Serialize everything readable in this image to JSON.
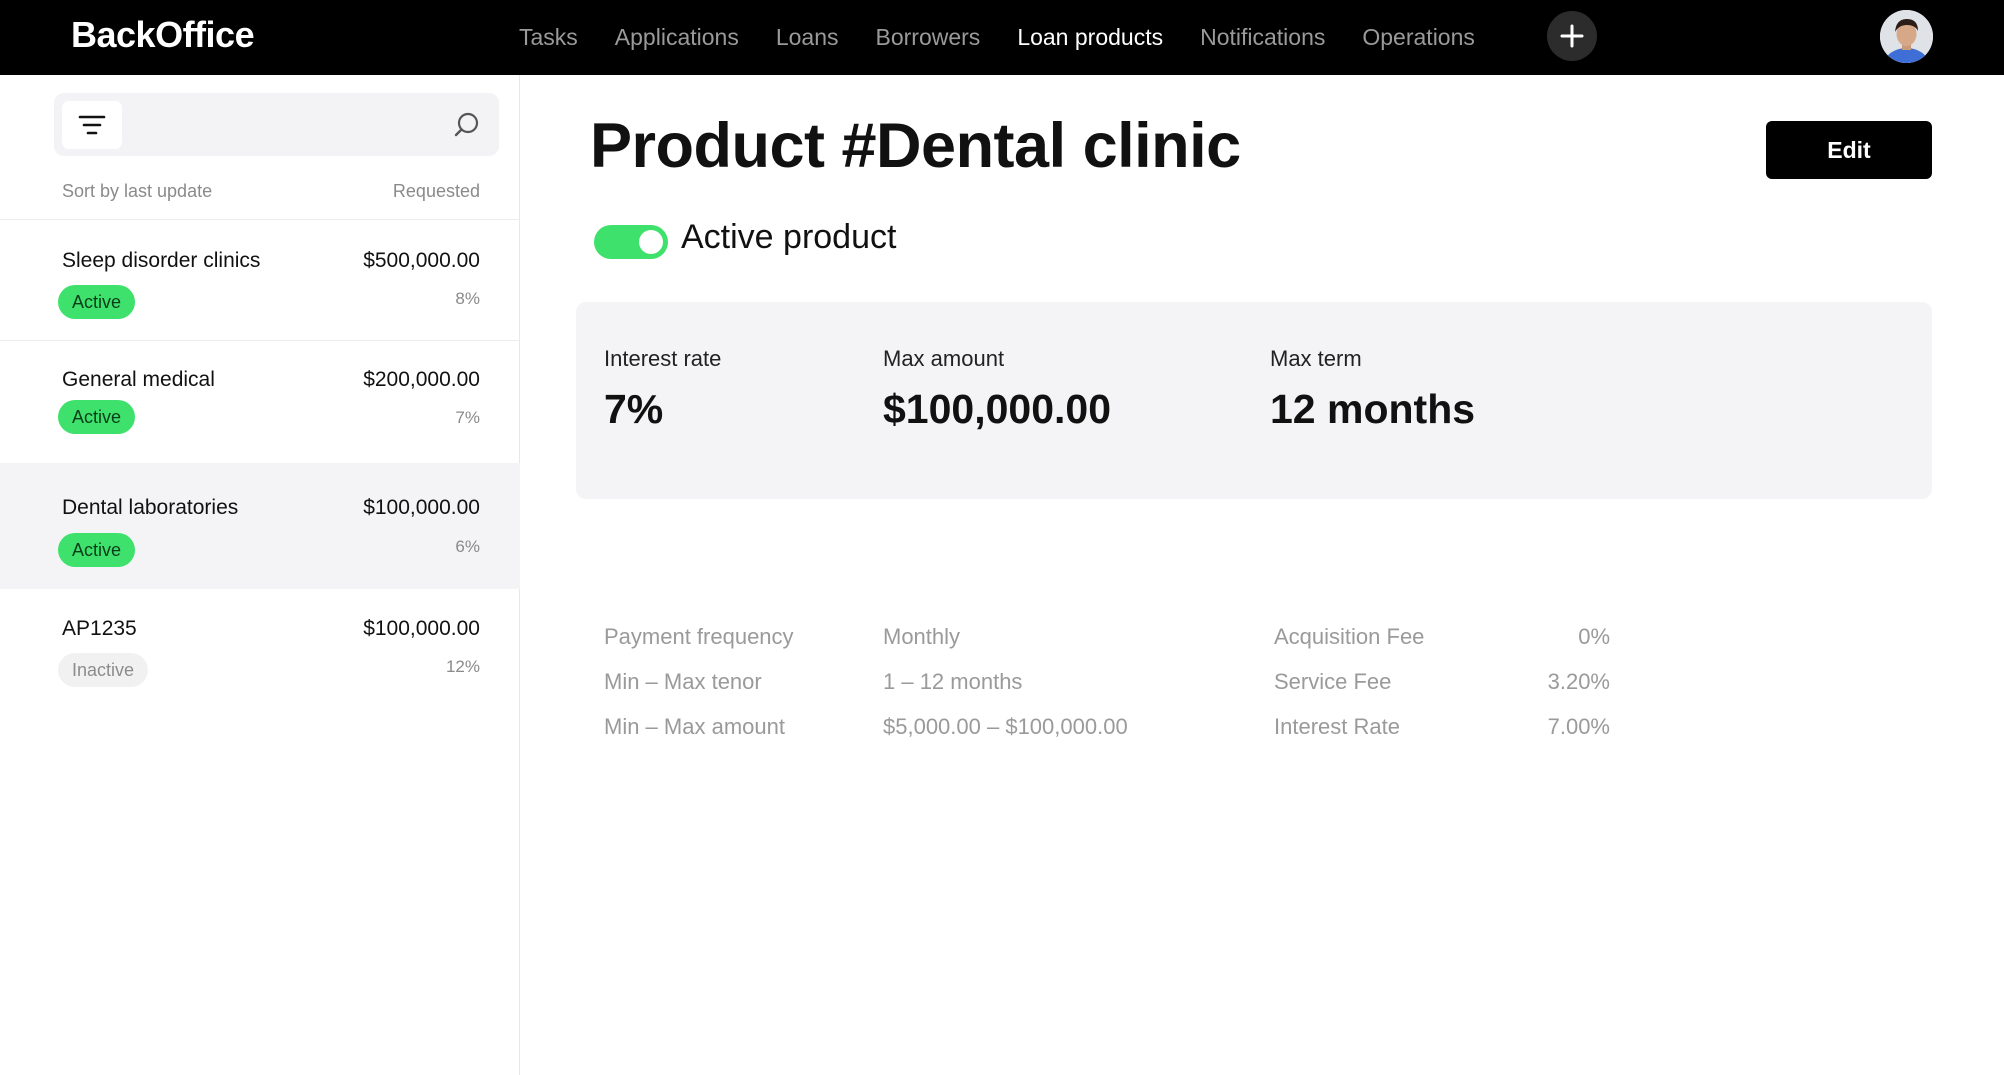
{
  "app": {
    "brand": "BackOffice"
  },
  "nav": {
    "items": [
      "Tasks",
      "Applications",
      "Loans",
      "Borrowers",
      "Loan products",
      "Notifications",
      "Operations"
    ],
    "active": "Loan products"
  },
  "sidebar": {
    "search_placeholder": "",
    "sort_label": "Sort by last update",
    "requested_label": "Requested",
    "items": [
      {
        "name": "Sleep disorder clinics",
        "amount": "$500,000.00",
        "rate": "8%",
        "status": "Active"
      },
      {
        "name": "General medical",
        "amount": "$200,000.00",
        "rate": "7%",
        "status": "Active"
      },
      {
        "name": "Dental laboratories",
        "amount": "$100,000.00",
        "rate": "6%",
        "status": "Active"
      },
      {
        "name": "AP1235",
        "amount": "$100,000.00",
        "rate": "12%",
        "status": "Inactive"
      }
    ]
  },
  "main": {
    "title": "Product #Dental clinic",
    "edit_label": "Edit",
    "toggle_label": "Active product",
    "stats": [
      {
        "label": "Interest rate",
        "value": "7%"
      },
      {
        "label": "Max amount",
        "value": "$100,000.00"
      },
      {
        "label": "Max term",
        "value": "12 months"
      }
    ],
    "details": [
      {
        "label": "Payment frequency",
        "value": "Monthly"
      },
      {
        "label": "Min – Max tenor",
        "value": "1 – 12 months"
      },
      {
        "label": "Min – Max amount",
        "value": "$5,000.00 – $100,000.00"
      }
    ],
    "fees": [
      {
        "label": "Acquisition Fee",
        "value": "0%"
      },
      {
        "label": "Service Fee",
        "value": "3.20%"
      },
      {
        "label": "Interest Rate",
        "value": "7.00%"
      }
    ]
  },
  "colors": {
    "accent_green": "#3de16b",
    "topbar": "#000000",
    "card_bg": "#f4f4f6"
  }
}
